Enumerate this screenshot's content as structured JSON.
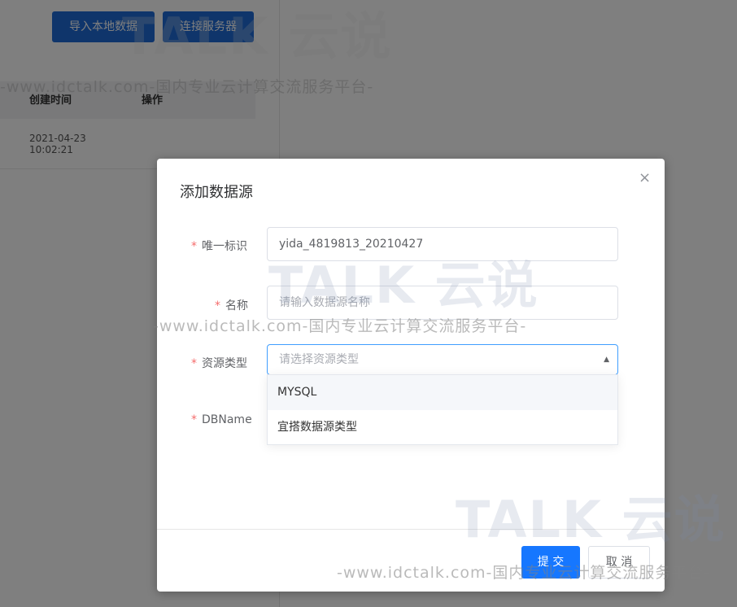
{
  "background": {
    "buttons": {
      "import_local": "导入本地数据",
      "connect_server": "连接服务器"
    },
    "table": {
      "headers": {
        "created_time": "创建时间",
        "actions": "操作"
      },
      "rows": [
        {
          "created_time": "2021-04-23\n10:02:21"
        }
      ]
    }
  },
  "watermark": {
    "logo": "TALK 云说",
    "tagline": "-www.idctalk.com-国内专业云计算交流服务平台-"
  },
  "dialog": {
    "title": "添加数据源",
    "close_symbol": "×",
    "required_mark": "*",
    "fields": {
      "unique_id": {
        "label": "唯一标识",
        "value": "yida_4819813_20210427"
      },
      "name": {
        "label": "名称",
        "placeholder": "请输入数据源名称"
      },
      "resource_type": {
        "label": "资源类型",
        "placeholder": "请选择资源类型"
      },
      "dbname": {
        "label": "DBName"
      }
    },
    "dropdown_options": [
      "MYSQL",
      "宜搭数据源类型"
    ],
    "buttons": {
      "submit": "提 交",
      "cancel": "取 消"
    }
  },
  "colors": {
    "primary": "#1677ff",
    "required": "#f56c6c",
    "focus_border": "#409eff"
  }
}
